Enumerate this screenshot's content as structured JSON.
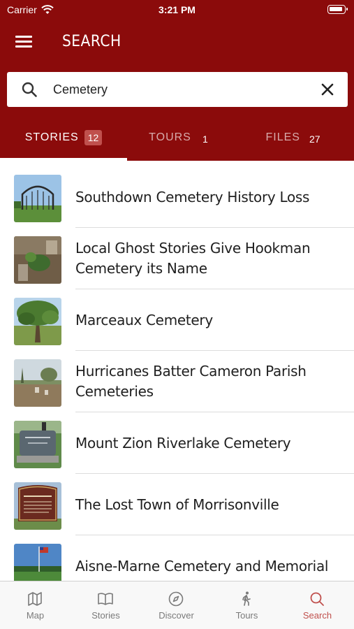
{
  "status_bar": {
    "carrier": "Carrier",
    "time": "3:21 PM"
  },
  "header": {
    "title": "SEARCH"
  },
  "search": {
    "value": "Cemetery"
  },
  "tabs": [
    {
      "label": "STORIES",
      "count": "12",
      "active": true
    },
    {
      "label": "TOURS",
      "count": "1",
      "active": false
    },
    {
      "label": "FILES",
      "count": "27",
      "active": false
    }
  ],
  "results": [
    {
      "title": "Southdown Cemetery History Loss",
      "thumb": "cemetery-gate"
    },
    {
      "title": "Local Ghost Stories Give Hookman Cemetery its Name",
      "thumb": "overgrown-grave"
    },
    {
      "title": "Marceaux Cemetery",
      "thumb": "oak-tree"
    },
    {
      "title": "Hurricanes Batter Cameron Parish Cemeteries",
      "thumb": "flooded-field"
    },
    {
      "title": "Mount Zion Riverlake Cemetery",
      "thumb": "granite-headstone"
    },
    {
      "title": "The Lost Town of Morrisonville",
      "thumb": "historical-marker"
    },
    {
      "title": "Aisne-Marne Cemetery and Memorial",
      "thumb": "memorial-flag"
    }
  ],
  "bottom_nav": [
    {
      "label": "Map",
      "icon": "map-icon"
    },
    {
      "label": "Stories",
      "icon": "book-icon"
    },
    {
      "label": "Discover",
      "icon": "compass-icon"
    },
    {
      "label": "Tours",
      "icon": "walking-icon"
    },
    {
      "label": "Search",
      "icon": "search-icon",
      "active": true
    }
  ],
  "colors": {
    "brand": "#8b0b0b",
    "accent": "#c0504d"
  }
}
